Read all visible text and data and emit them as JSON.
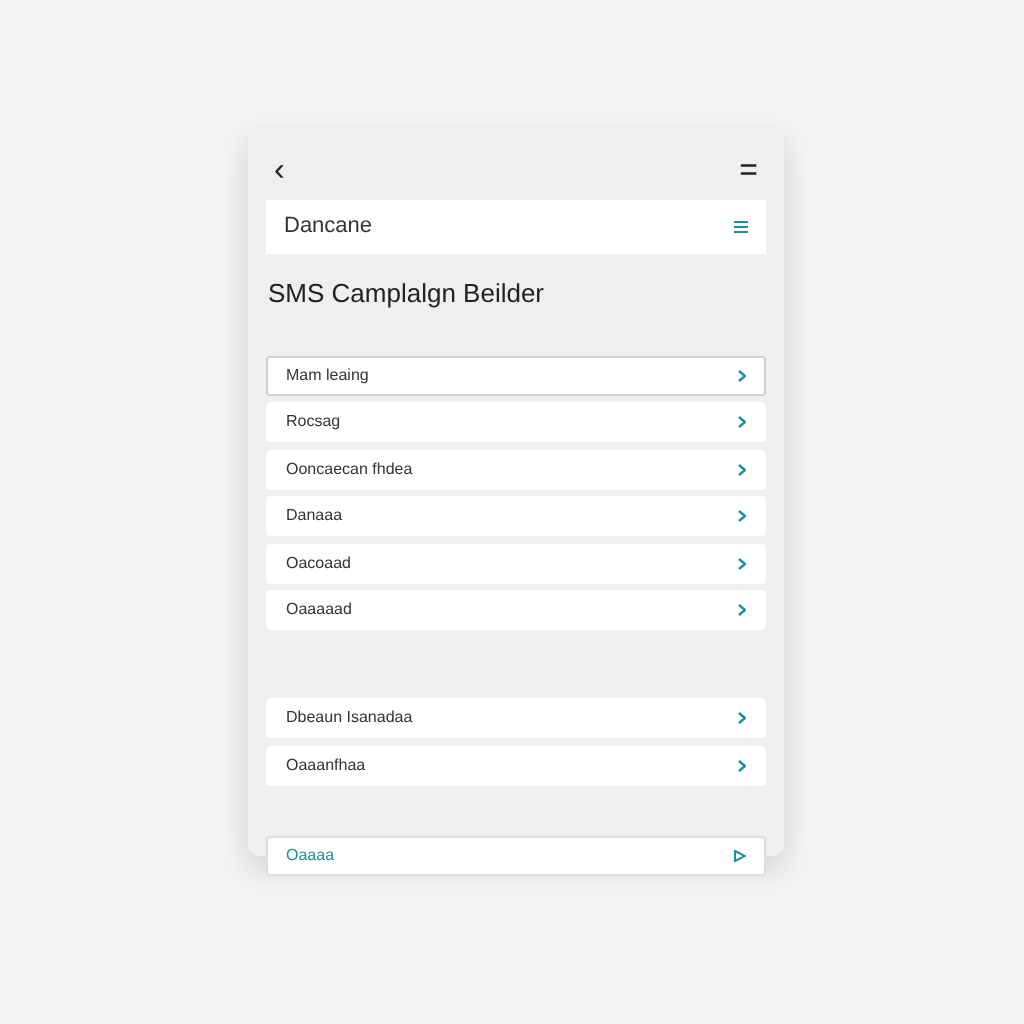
{
  "header": {
    "back": "‹",
    "menu": "="
  },
  "section_bar": {
    "label": "Dancane"
  },
  "title": "SMS Camplalgn Beilder",
  "items": [
    {
      "label": "Mam leaing",
      "selected": true
    },
    {
      "label": "Rocsag",
      "selected": false
    },
    {
      "label": "Ooncaecan fhdea",
      "selected": false
    },
    {
      "label": "Danaaa",
      "selected": false
    },
    {
      "label": "Oacoaad",
      "selected": false
    },
    {
      "label": "Oaaaaad",
      "selected": false
    }
  ],
  "items_lower": [
    {
      "label": "Dbeaun Isanadaa",
      "selected": false
    },
    {
      "label": "Oaaanfhaa",
      "selected": false
    }
  ],
  "footer_action": {
    "label": "Oaaaa"
  }
}
